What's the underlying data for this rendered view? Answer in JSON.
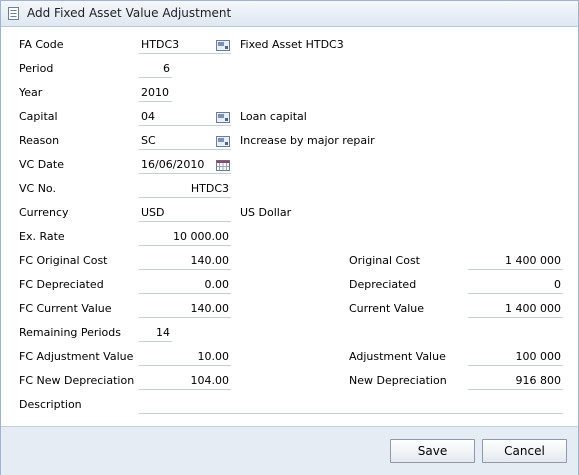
{
  "dialog": {
    "title": "Add Fixed Asset Value Adjustment"
  },
  "fields": {
    "fa_code": {
      "label": "FA Code",
      "value": "HTDC3",
      "desc_prefix": "Fixed Asset",
      "desc": "HTDC3"
    },
    "period": {
      "label": "Period",
      "value": "6"
    },
    "year": {
      "label": "Year",
      "value": "2010"
    },
    "capital": {
      "label": "Capital",
      "value": "04",
      "desc": "Loan capital"
    },
    "reason": {
      "label": "Reason",
      "value": "SC",
      "desc": "Increase by major repair"
    },
    "vc_date": {
      "label": "VC Date",
      "value": "16/06/2010"
    },
    "vc_no": {
      "label": "VC No.",
      "value": "HTDC3"
    },
    "currency": {
      "label": "Currency",
      "value": "USD",
      "desc": "US Dollar"
    },
    "ex_rate": {
      "label": "Ex. Rate",
      "value": "10 000.00"
    },
    "fc_original_cost": {
      "label": "FC Original Cost",
      "value": "140.00"
    },
    "fc_depreciated": {
      "label": "FC Depreciated",
      "value": "0.00"
    },
    "fc_current_value": {
      "label": "FC Current Value",
      "value": "140.00"
    },
    "remaining_periods": {
      "label": "Remaining Periods",
      "value": "14"
    },
    "fc_adjustment_value": {
      "label": "FC Adjustment Value",
      "value": "10.00"
    },
    "fc_new_depreciation": {
      "label": "FC New Depreciation",
      "value": "104.00"
    },
    "description": {
      "label": "Description",
      "value": ""
    },
    "original_cost": {
      "label": "Original Cost",
      "value": "1 400 000"
    },
    "depreciated": {
      "label": "Depreciated",
      "value": "0"
    },
    "current_value": {
      "label": "Current Value",
      "value": "1 400 000"
    },
    "adjustment_value": {
      "label": "Adjustment Value",
      "value": "100 000"
    },
    "new_depreciation": {
      "label": "New Depreciation",
      "value": "916 800"
    }
  },
  "buttons": {
    "save": "Save",
    "cancel": "Cancel"
  },
  "icons": {
    "title": "form-icon",
    "lookup": "lookup-icon",
    "calendar": "calendar-icon"
  }
}
